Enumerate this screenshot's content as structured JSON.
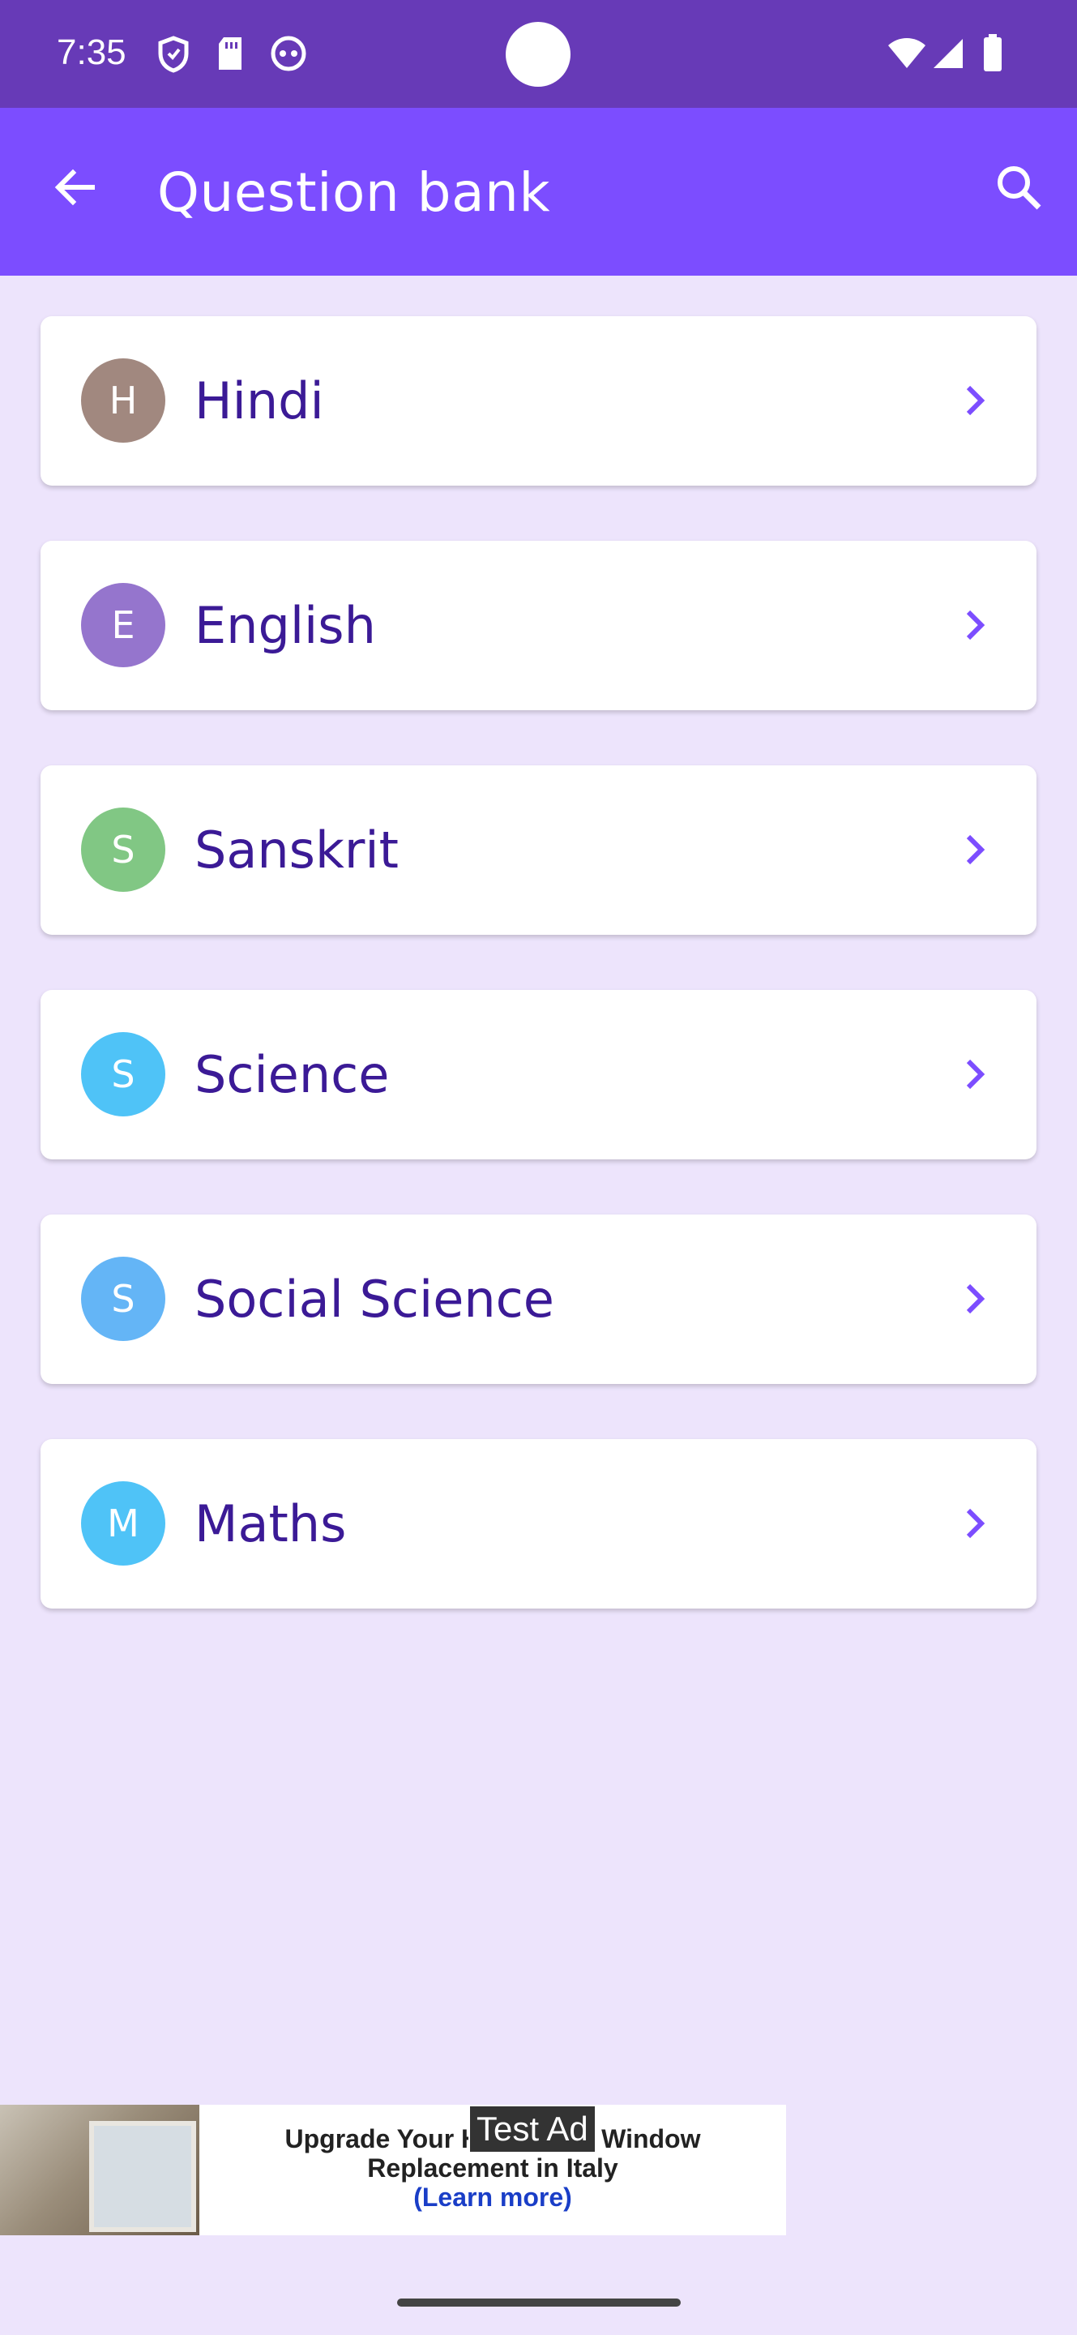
{
  "status_bar": {
    "time": "7:35",
    "icons": [
      "shield-icon",
      "sd-card-icon",
      "android-icon",
      "wifi-icon",
      "cellular-icon",
      "battery-icon"
    ]
  },
  "app_bar": {
    "title": "Question bank",
    "back_icon": "arrow-back-icon",
    "search_icon": "search-icon",
    "background": "#7c4dff"
  },
  "subjects": [
    {
      "initial": "H",
      "label": "Hindi",
      "color": "#a1887f"
    },
    {
      "initial": "E",
      "label": "English",
      "color": "#9575cd"
    },
    {
      "initial": "S",
      "label": "Sanskrit",
      "color": "#81c784"
    },
    {
      "initial": "S",
      "label": "Science",
      "color": "#4fc3f7"
    },
    {
      "initial": "S",
      "label": "Social Science",
      "color": "#64b5f6"
    },
    {
      "initial": "M",
      "label": "Maths",
      "color": "#4fc3f7"
    }
  ],
  "ad": {
    "tag": "Test Ad",
    "line1": "Upgrade Your H",
    "line1_tail": "Window",
    "line2": "Replacement in Italy",
    "cta": "(Learn more)"
  },
  "colors": {
    "status_bar": "#673ab7",
    "background": "#ede4fc",
    "label_text": "#3b1a96",
    "chevron": "#7c4dff"
  }
}
